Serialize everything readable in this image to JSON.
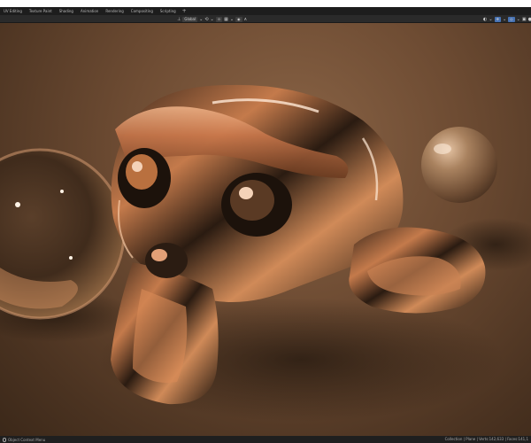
{
  "workspace_tabs": [
    "UV Editing",
    "Texture Paint",
    "Shading",
    "Animation",
    "Rendering",
    "Compositing",
    "Scripting"
  ],
  "tab_add_glyph": "+",
  "viewport_header": {
    "transform_orientation": "Global",
    "dropdown_glyph": "⌄"
  },
  "statusbar": {
    "left_text": "Object Context Menu",
    "right_text": "Collection | Plane | Verts:142,633 | Faces:141,1"
  },
  "scene": {
    "objects": [
      "glass-sphere",
      "chrome-monkey",
      "matte-sphere"
    ],
    "colors": {
      "background": "#6e4c33",
      "copper": "#c9774b",
      "chrome_dark": "#1e140d",
      "matte": "#a07a5c",
      "ui_bar": "#1d1d1d",
      "accent": "#4772b3"
    }
  }
}
